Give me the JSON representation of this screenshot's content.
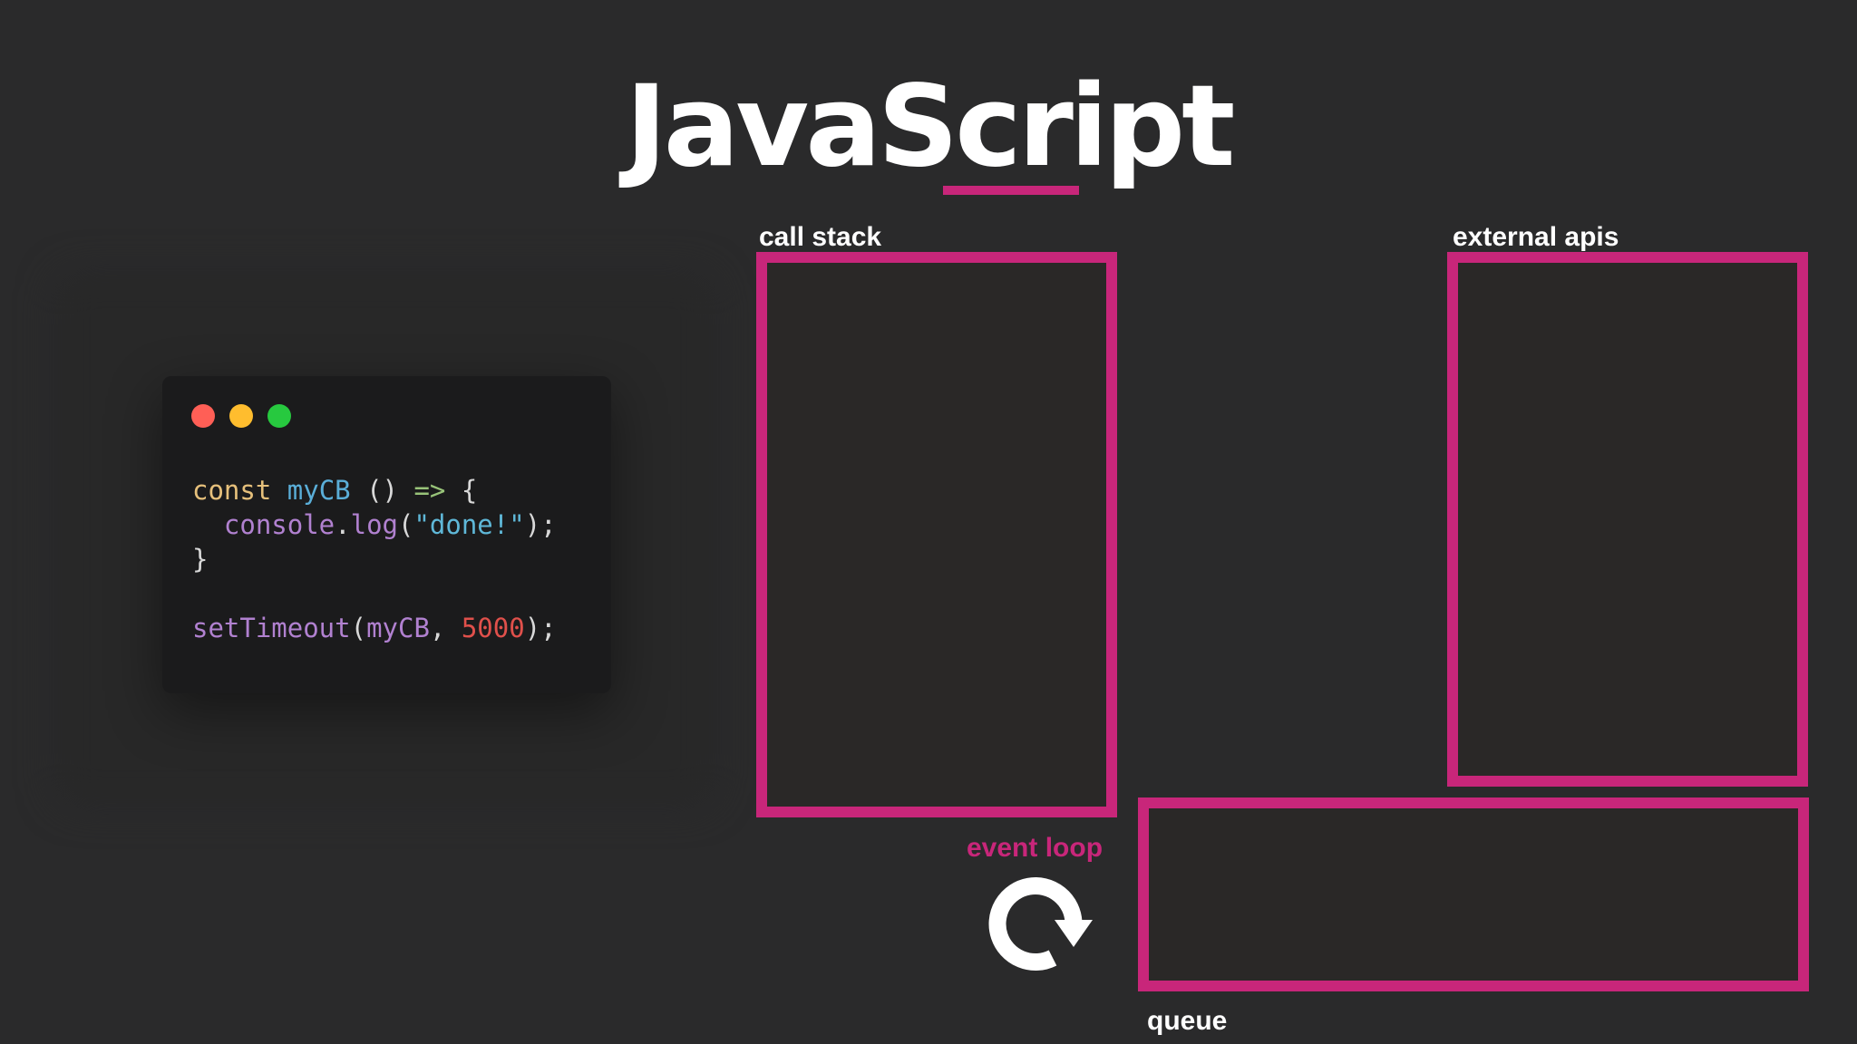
{
  "title": "JavaScript",
  "code_window": {
    "lines": [
      [
        {
          "t": "const",
          "c": "kw"
        },
        {
          "t": " ",
          "c": "pl"
        },
        {
          "t": "myCB",
          "c": "id"
        },
        {
          "t": " () ",
          "c": "pl"
        },
        {
          "t": "=>",
          "c": "op"
        },
        {
          "t": " {",
          "c": "pl"
        }
      ],
      [
        {
          "t": "  ",
          "c": "pl"
        },
        {
          "t": "console",
          "c": "fn"
        },
        {
          "t": ".",
          "c": "pl"
        },
        {
          "t": "log",
          "c": "fn"
        },
        {
          "t": "(",
          "c": "pl"
        },
        {
          "t": "\"done!\"",
          "c": "str"
        },
        {
          "t": ");",
          "c": "pl"
        }
      ],
      [
        {
          "t": "}",
          "c": "pl"
        }
      ],
      [],
      [
        {
          "t": "setTimeout",
          "c": "fn"
        },
        {
          "t": "(",
          "c": "pl"
        },
        {
          "t": "myCB",
          "c": "fn"
        },
        {
          "t": ", ",
          "c": "pl"
        },
        {
          "t": "5000",
          "c": "num"
        },
        {
          "t": ");",
          "c": "pl"
        }
      ]
    ]
  },
  "labels": {
    "call_stack": "call stack",
    "external_apis": "external apis",
    "event_loop": "event loop",
    "queue": "queue"
  },
  "colors": {
    "accent": "#c8267a",
    "background": "#2a2a2b",
    "code_bg": "#1b1b1c"
  },
  "icons": {
    "event_loop": "circular-arrow-icon"
  }
}
